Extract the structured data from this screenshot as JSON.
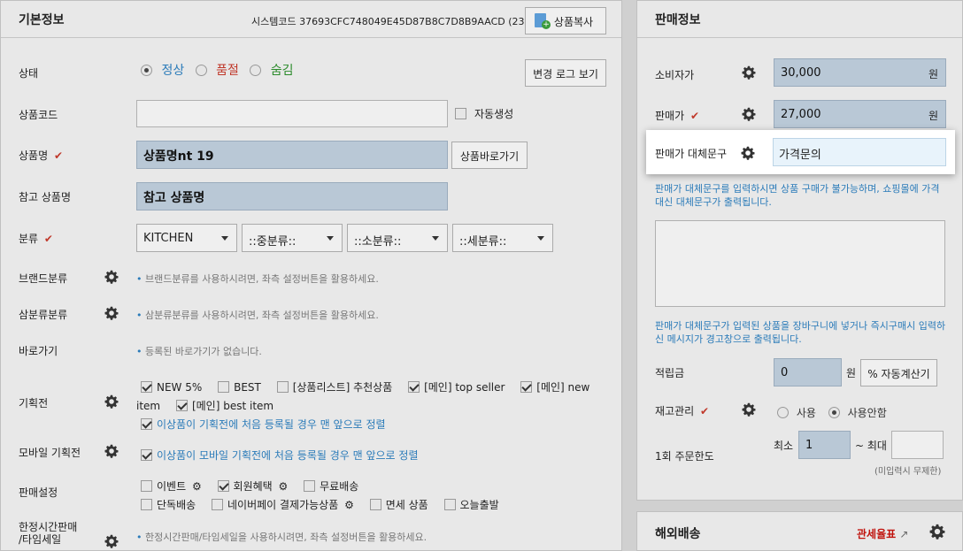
{
  "left": {
    "title": "기본정보",
    "system_code": "시스템코드 37693CFC748049E45D87B8C7D8B9AACD (23)",
    "copy_button": "상품복사",
    "status_label": "상태",
    "status_options": [
      "정상",
      "품절",
      "숨김"
    ],
    "change_log_button": "변경 로그 보기",
    "product_code_label": "상품코드",
    "auto_generate_label": "자동생성",
    "product_name_label": "상품명",
    "product_name_value": "상품명nt 19",
    "product_shortcut_button": "상품바로가기",
    "ref_name_label": "참고 상품명",
    "ref_name_value": "참고 상품명",
    "category_label": "분류",
    "category_values": [
      "KITCHEN",
      "::중분류::",
      "::소분류::",
      "::세분류::"
    ],
    "brand_label": "브랜드분류",
    "brand_hint": "브랜드분류를 사용하시려면, 좌측 설정버튼을 활용하세요.",
    "sam_label": "삼분류분류",
    "sam_hint": "삼분류분류를 사용하시려면, 좌측 설정버튼을 활용하세요.",
    "shortcut_label": "바로가기",
    "shortcut_hint": "등록된 바로가기가 없습니다.",
    "exhibit_label": "기획전",
    "exhibit_items": [
      "NEW 5%",
      "BEST",
      "[상품리스트] 추천상품",
      "[메인] top seller",
      "[메인] new"
    ],
    "exhibit_item_cont": "item",
    "exhibit_item_last": "[메인] best item",
    "exhibit_sort": "이상품이 기획전에 처음 등록될 경우 맨 앞으로 정렬",
    "mobile_exhibit_label": "모바일 기획전",
    "mobile_exhibit_sort": "이상품이 모바일 기획전에 처음 등록될 경우 맨 앞으로 정렬",
    "sale_setting_label": "판매설정",
    "sale_settings_row1": [
      "이벤트",
      "회원혜택",
      "무료배송"
    ],
    "sale_settings_row2": [
      "단독배송",
      "네이버페이 결제가능상품",
      "면세 상품",
      "오늘출발"
    ],
    "time_sale_label_1": "한정시간판매",
    "time_sale_label_2": "/타임세일",
    "time_sale_hint": "한정시간판매/타임세일을 사용하시려면, 좌측 설정버튼을 활용하세요."
  },
  "right": {
    "title": "판매정보",
    "consumer_price_label": "소비자가",
    "consumer_price_value": "30,000",
    "sale_price_label": "판매가",
    "sale_price_value": "27,000",
    "currency": "원",
    "alt_text_label": "판매가 대체문구",
    "alt_text_value": "가격문의",
    "alt_text_help": "판매가 대체문구를 입력하시면 상품 구매가 불가능하며, 쇼핑몰에 가격대신 대체문구가 출력됩니다.",
    "alt_text_help2": "판매가 대체문구가 입력된 상품을 장바구니에 넣거나 즉시구매시 입력하신 메시지가 경고창으로 출력됩니다.",
    "points_label": "적립금",
    "points_value": "0",
    "points_unit": "원",
    "auto_calc_button": "% 자동계산기",
    "stock_label": "재고관리",
    "stock_options": [
      "사용",
      "사용안함"
    ],
    "min_label": "최소",
    "min_value": "1",
    "max_label": "~ 최대",
    "order_limit_label": "1회 주문한도",
    "order_limit_note": "(미입력시 무제한)"
  },
  "overseas": {
    "title": "해외배송",
    "tariff_link": "관세율표"
  },
  "colors": {
    "accent_blue": "#2b7bb9",
    "danger_red": "#c0392b",
    "ok_green": "#2a8a2a",
    "highlight_bg": "#ffffff",
    "filled_field": "#b9c8d6"
  }
}
